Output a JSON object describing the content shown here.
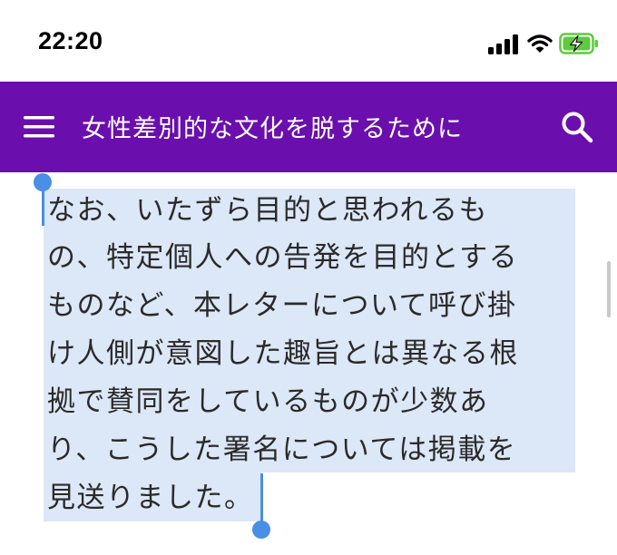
{
  "status_bar": {
    "time": "22:20",
    "icons": [
      "signal-icon",
      "wifi-icon",
      "battery-charging-icon"
    ],
    "battery_color": "#5ccb3c"
  },
  "app_bar": {
    "title": "女性差別的な文化を脱するために",
    "background": "#6a0fae",
    "icons": [
      "menu-icon",
      "search-icon"
    ]
  },
  "content": {
    "lines": [
      "なお、いたずら目的と思われるも",
      "の、特定個人への告発を目的とする",
      "ものなど、本レターについて呼び掛",
      "け人側が意図した趣旨とは異なる根",
      "拠で賛同をしているものが少数あ",
      "り、こうした署名については掲載を",
      "見送りました。"
    ],
    "selection_color": "#dce7f7",
    "handle_color": "#4a8ee6"
  }
}
